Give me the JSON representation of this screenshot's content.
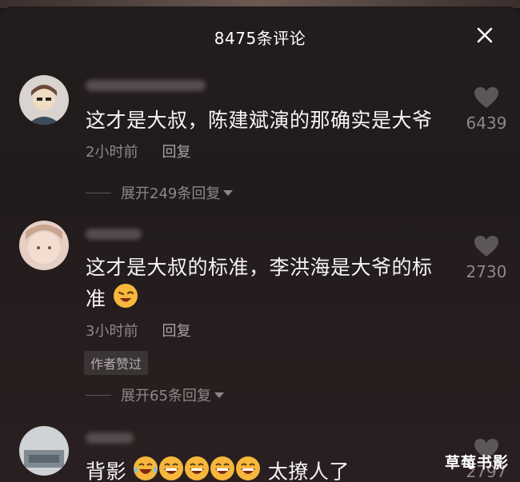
{
  "header": {
    "title": "8475条评论"
  },
  "comments": [
    {
      "text": "这才是大叔，陈建斌演的那确实是大爷",
      "time": "2小时前",
      "reply_label": "回复",
      "likes": "6439",
      "expand_label": "展开249条回复"
    },
    {
      "text_line1": "这才是大叔的标准，李洪海是大爷的标",
      "text_line2": "准",
      "time": "3小时前",
      "reply_label": "回复",
      "likes": "2730",
      "badge": "作者赞过",
      "expand_label": "展开65条回复"
    },
    {
      "text_prefix": "背影",
      "text_suffix": "太撩人了",
      "likes": "2797"
    }
  ],
  "watermark": "草莓书影",
  "colors": {
    "background": "#221b1c",
    "text": "#f4f4f4",
    "muted": "#8e8788"
  }
}
